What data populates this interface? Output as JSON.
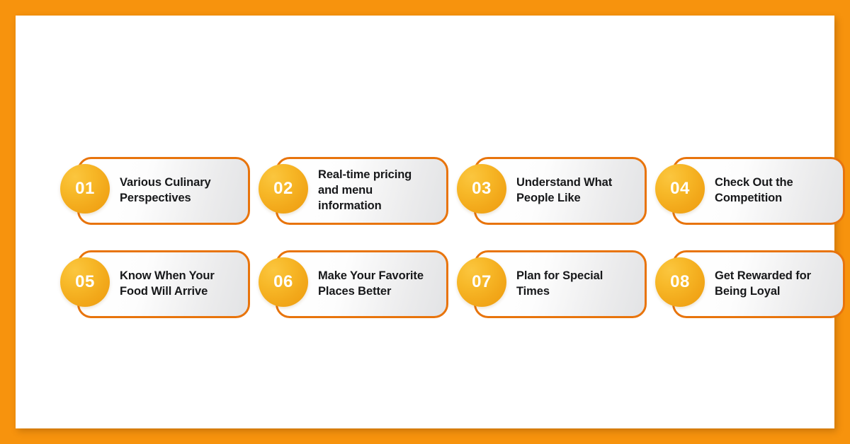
{
  "frame": {
    "border_color": "#F7930D",
    "canvas_color": "#FFFFFF"
  },
  "theme": {
    "accent_orange": "#E8740C",
    "badge_gradient_start": "#FBC63F",
    "badge_gradient_end": "#EE9B0E",
    "card_fill_start": "#FFFFFF",
    "card_fill_end": "#E2E3E5",
    "text_color": "#17181A",
    "number_color": "#FFFFFF"
  },
  "cards": [
    {
      "number": "01",
      "label": "Various Culinary\nPerspectives"
    },
    {
      "number": "02",
      "label": "Real-time pricing\nand menu\ninformation"
    },
    {
      "number": "03",
      "label": "Understand What\nPeople Like"
    },
    {
      "number": "04",
      "label": "Check Out the\nCompetition"
    },
    {
      "number": "05",
      "label": "Know When Your\nFood Will Arrive"
    },
    {
      "number": "06",
      "label": "Make Your Favorite\nPlaces Better"
    },
    {
      "number": "07",
      "label": "Plan for Special\nTimes"
    },
    {
      "number": "08",
      "label": "Get Rewarded for\nBeing Loyal"
    }
  ]
}
